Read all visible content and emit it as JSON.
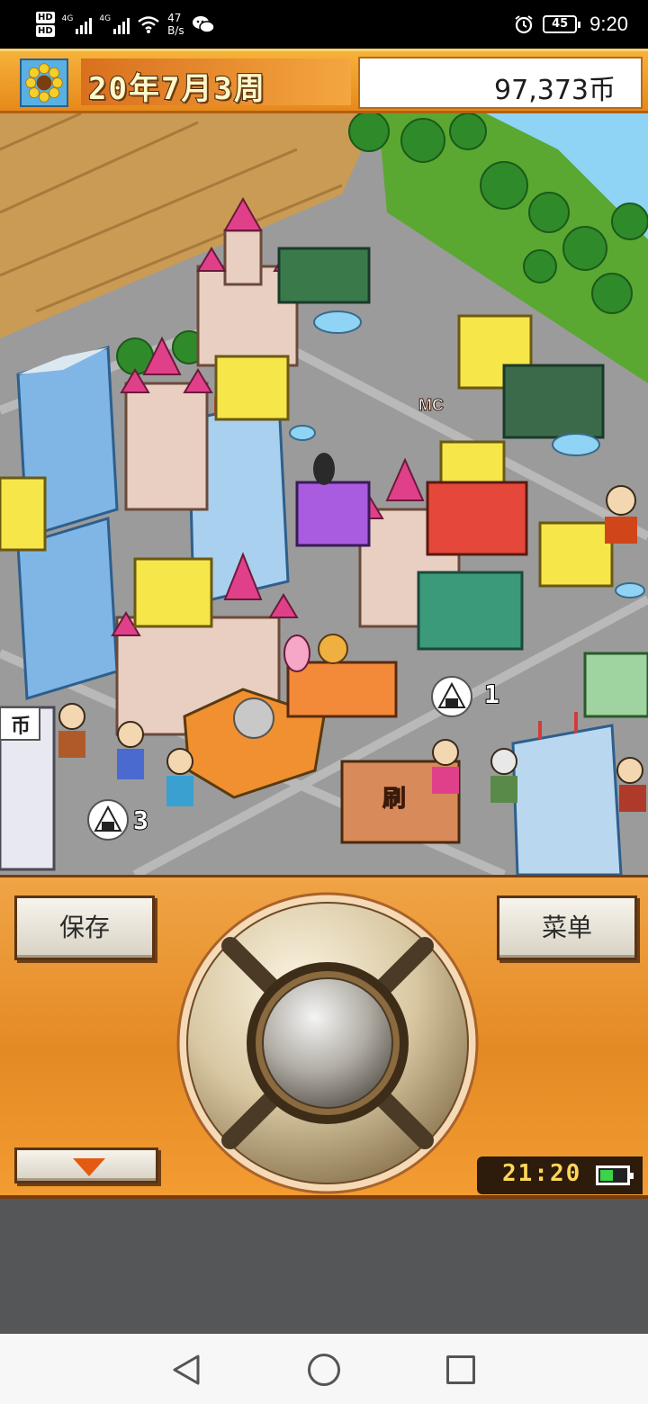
{
  "status_bar": {
    "hd1": "HD",
    "hd2": "HD",
    "signal1_label": "4G",
    "signal2_label": "4G",
    "net_speed_value": "47",
    "net_speed_unit": "B/s",
    "battery_level": "45",
    "time": "9:20"
  },
  "hud": {
    "date": "20年7月3周",
    "money": "97,373币"
  },
  "map": {
    "coin_label": "币",
    "count_a": "3",
    "count_b": "1",
    "sign_a": "刷",
    "sign_b": "MC"
  },
  "controls": {
    "save_label": "保存",
    "menu_label": "菜单",
    "game_clock": "21:20"
  },
  "colors": {
    "hud_orange": "#f0a038",
    "panel_orange": "#e48a24",
    "road_gray": "#9b9b9b",
    "grass_green": "#5aa832"
  }
}
